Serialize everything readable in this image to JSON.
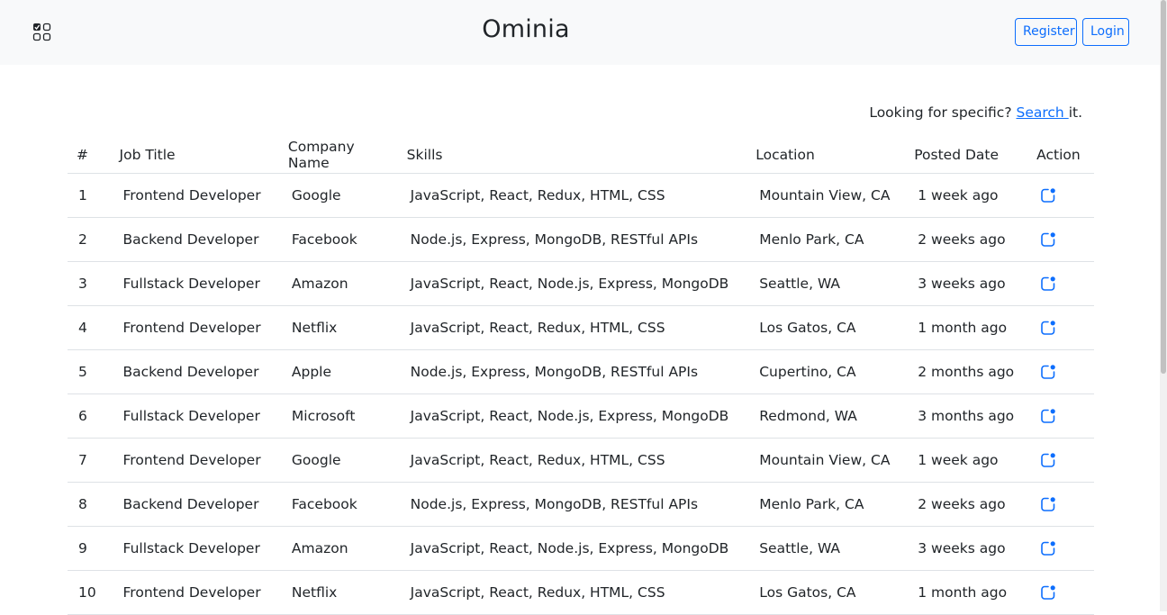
{
  "app": {
    "title": "Ominia"
  },
  "header": {
    "logo_icon": "checklist-grid-icon",
    "register_label": "Register",
    "login_label": "Login"
  },
  "search_hint": {
    "prefix": "Looking for specific? ",
    "link_label": "Search ",
    "suffix": "it."
  },
  "table": {
    "columns": [
      "#",
      "Job Title",
      "Company Name",
      "Skills",
      "Location",
      "Posted Date",
      "Action"
    ],
    "action_icon": "edit-icon",
    "rows": [
      {
        "num": "1",
        "title": "Frontend Developer",
        "company": "Google",
        "skills": "JavaScript, React, Redux, HTML, CSS",
        "location": "Mountain View, CA",
        "posted": "1 week ago"
      },
      {
        "num": "2",
        "title": "Backend Developer",
        "company": "Facebook",
        "skills": "Node.js, Express, MongoDB, RESTful APIs",
        "location": "Menlo Park, CA",
        "posted": "2 weeks ago"
      },
      {
        "num": "3",
        "title": "Fullstack Developer",
        "company": "Amazon",
        "skills": "JavaScript, React, Node.js, Express, MongoDB",
        "location": "Seattle, WA",
        "posted": "3 weeks ago"
      },
      {
        "num": "4",
        "title": "Frontend Developer",
        "company": "Netflix",
        "skills": "JavaScript, React, Redux, HTML, CSS",
        "location": "Los Gatos, CA",
        "posted": "1 month ago"
      },
      {
        "num": "5",
        "title": "Backend Developer",
        "company": "Apple",
        "skills": "Node.js, Express, MongoDB, RESTful APIs",
        "location": "Cupertino, CA",
        "posted": "2 months ago"
      },
      {
        "num": "6",
        "title": "Fullstack Developer",
        "company": "Microsoft",
        "skills": "JavaScript, React, Node.js, Express, MongoDB",
        "location": "Redmond, WA",
        "posted": "3 months ago"
      },
      {
        "num": "7",
        "title": "Frontend Developer",
        "company": "Google",
        "skills": "JavaScript, React, Redux, HTML, CSS",
        "location": "Mountain View, CA",
        "posted": "1 week ago"
      },
      {
        "num": "8",
        "title": "Backend Developer",
        "company": "Facebook",
        "skills": "Node.js, Express, MongoDB, RESTful APIs",
        "location": "Menlo Park, CA",
        "posted": "2 weeks ago"
      },
      {
        "num": "9",
        "title": "Fullstack Developer",
        "company": "Amazon",
        "skills": "JavaScript, React, Node.js, Express, MongoDB",
        "location": "Seattle, WA",
        "posted": "3 weeks ago"
      },
      {
        "num": "10",
        "title": "Frontend Developer",
        "company": "Netflix",
        "skills": "JavaScript, React, Redux, HTML, CSS",
        "location": "Los Gatos, CA",
        "posted": "1 month ago"
      }
    ]
  },
  "colors": {
    "accent": "#0d6efd",
    "navbar_bg": "#f8f9fa",
    "text": "#212529",
    "border": "#dee2e6"
  }
}
